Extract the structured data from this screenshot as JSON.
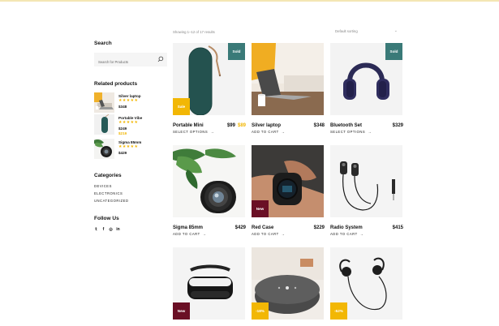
{
  "sidebar": {
    "search_title": "Search",
    "search_placeholder": "Search for Products",
    "related_title": "Related products",
    "related": [
      {
        "name": "Silver laptop",
        "stars": "★★★★★",
        "price": "$348",
        "price_sale": ""
      },
      {
        "name": "Portable Vibe",
        "stars": "★★★★★",
        "price": "$249",
        "price_sale": "$219"
      },
      {
        "name": "Sigma 85mm",
        "stars": "★★★★★",
        "price": "$429",
        "price_sale": ""
      }
    ],
    "categories_title": "Categories",
    "categories": [
      "DEVICES",
      "ELECTRONICS",
      "UNCATEGORIZED"
    ],
    "follow_title": "Follow Us",
    "social_icons": [
      "twitter-icon",
      "facebook-icon",
      "instagram-icon",
      "linkedin-icon"
    ],
    "social_glyphs": [
      "𝕥",
      "f",
      "◎",
      "in"
    ]
  },
  "toolbar": {
    "results": "Showing 1–12 of 17 results",
    "sorting": "Default sorting",
    "sorting_chevron": "⌄"
  },
  "products": [
    {
      "name": "Portable Mini",
      "price": "$99",
      "price_sale": "$89",
      "action": "SELECT OPTIONS",
      "badge_top": "Sold",
      "badge_bottom": "Sale"
    },
    {
      "name": "Silver laptop",
      "price": "$348",
      "price_sale": "",
      "action": "ADD TO CART",
      "badge_top": "",
      "badge_bottom": ""
    },
    {
      "name": "Bluetooth Set",
      "price": "$329",
      "price_sale": "",
      "action": "SELECT OPTIONS",
      "badge_top": "Sold",
      "badge_bottom": ""
    },
    {
      "name": "Sigma 85mm",
      "price": "$429",
      "price_sale": "",
      "action": "ADD TO CART",
      "badge_top": "",
      "badge_bottom": ""
    },
    {
      "name": "Red Case",
      "price": "$229",
      "price_sale": "",
      "action": "ADD TO CART",
      "badge_top": "",
      "badge_bottom": "New"
    },
    {
      "name": "Radio System",
      "price": "$415",
      "price_sale": "",
      "action": "ADD TO CART",
      "badge_top": "",
      "badge_bottom": ""
    },
    {
      "name": "",
      "price": "",
      "price_sale": "",
      "action": "",
      "badge_top": "",
      "badge_bottom": "New"
    },
    {
      "name": "",
      "price": "",
      "price_sale": "",
      "action": "",
      "badge_top": "",
      "badge_bottom": "-18%"
    },
    {
      "name": "",
      "price": "",
      "price_sale": "",
      "action": "",
      "badge_top": "",
      "badge_bottom": "-52%"
    }
  ],
  "action_arrow": "→",
  "colors": {
    "accent": "#f2b705",
    "teal": "#3a7a78",
    "maroon": "#6a0f25"
  }
}
